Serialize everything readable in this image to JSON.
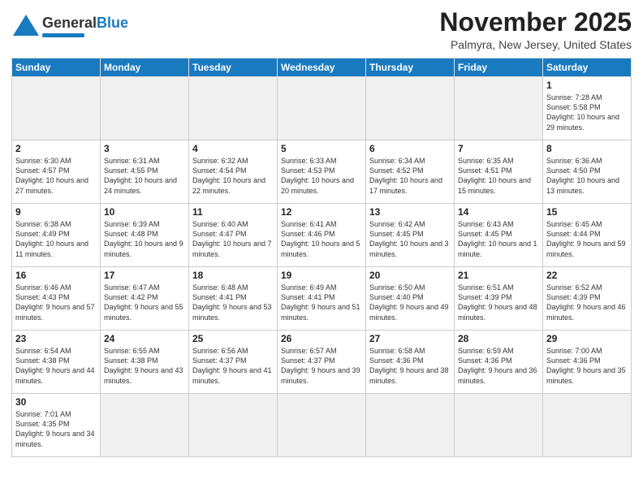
{
  "header": {
    "logo_general": "General",
    "logo_blue": "Blue",
    "month_title": "November 2025",
    "location": "Palmyra, New Jersey, United States"
  },
  "days_of_week": [
    "Sunday",
    "Monday",
    "Tuesday",
    "Wednesday",
    "Thursday",
    "Friday",
    "Saturday"
  ],
  "weeks": [
    [
      {
        "day": "",
        "info": ""
      },
      {
        "day": "",
        "info": ""
      },
      {
        "day": "",
        "info": ""
      },
      {
        "day": "",
        "info": ""
      },
      {
        "day": "",
        "info": ""
      },
      {
        "day": "",
        "info": ""
      },
      {
        "day": "1",
        "info": "Sunrise: 7:28 AM\nSunset: 5:58 PM\nDaylight: 10 hours and 29 minutes."
      }
    ],
    [
      {
        "day": "2",
        "info": "Sunrise: 6:30 AM\nSunset: 4:57 PM\nDaylight: 10 hours and 27 minutes."
      },
      {
        "day": "3",
        "info": "Sunrise: 6:31 AM\nSunset: 4:55 PM\nDaylight: 10 hours and 24 minutes."
      },
      {
        "day": "4",
        "info": "Sunrise: 6:32 AM\nSunset: 4:54 PM\nDaylight: 10 hours and 22 minutes."
      },
      {
        "day": "5",
        "info": "Sunrise: 6:33 AM\nSunset: 4:53 PM\nDaylight: 10 hours and 20 minutes."
      },
      {
        "day": "6",
        "info": "Sunrise: 6:34 AM\nSunset: 4:52 PM\nDaylight: 10 hours and 17 minutes."
      },
      {
        "day": "7",
        "info": "Sunrise: 6:35 AM\nSunset: 4:51 PM\nDaylight: 10 hours and 15 minutes."
      },
      {
        "day": "8",
        "info": "Sunrise: 6:36 AM\nSunset: 4:50 PM\nDaylight: 10 hours and 13 minutes."
      }
    ],
    [
      {
        "day": "9",
        "info": "Sunrise: 6:38 AM\nSunset: 4:49 PM\nDaylight: 10 hours and 11 minutes."
      },
      {
        "day": "10",
        "info": "Sunrise: 6:39 AM\nSunset: 4:48 PM\nDaylight: 10 hours and 9 minutes."
      },
      {
        "day": "11",
        "info": "Sunrise: 6:40 AM\nSunset: 4:47 PM\nDaylight: 10 hours and 7 minutes."
      },
      {
        "day": "12",
        "info": "Sunrise: 6:41 AM\nSunset: 4:46 PM\nDaylight: 10 hours and 5 minutes."
      },
      {
        "day": "13",
        "info": "Sunrise: 6:42 AM\nSunset: 4:45 PM\nDaylight: 10 hours and 3 minutes."
      },
      {
        "day": "14",
        "info": "Sunrise: 6:43 AM\nSunset: 4:45 PM\nDaylight: 10 hours and 1 minute."
      },
      {
        "day": "15",
        "info": "Sunrise: 6:45 AM\nSunset: 4:44 PM\nDaylight: 9 hours and 59 minutes."
      }
    ],
    [
      {
        "day": "16",
        "info": "Sunrise: 6:46 AM\nSunset: 4:43 PM\nDaylight: 9 hours and 57 minutes."
      },
      {
        "day": "17",
        "info": "Sunrise: 6:47 AM\nSunset: 4:42 PM\nDaylight: 9 hours and 55 minutes."
      },
      {
        "day": "18",
        "info": "Sunrise: 6:48 AM\nSunset: 4:41 PM\nDaylight: 9 hours and 53 minutes."
      },
      {
        "day": "19",
        "info": "Sunrise: 6:49 AM\nSunset: 4:41 PM\nDaylight: 9 hours and 51 minutes."
      },
      {
        "day": "20",
        "info": "Sunrise: 6:50 AM\nSunset: 4:40 PM\nDaylight: 9 hours and 49 minutes."
      },
      {
        "day": "21",
        "info": "Sunrise: 6:51 AM\nSunset: 4:39 PM\nDaylight: 9 hours and 48 minutes."
      },
      {
        "day": "22",
        "info": "Sunrise: 6:52 AM\nSunset: 4:39 PM\nDaylight: 9 hours and 46 minutes."
      }
    ],
    [
      {
        "day": "23",
        "info": "Sunrise: 6:54 AM\nSunset: 4:38 PM\nDaylight: 9 hours and 44 minutes."
      },
      {
        "day": "24",
        "info": "Sunrise: 6:55 AM\nSunset: 4:38 PM\nDaylight: 9 hours and 43 minutes."
      },
      {
        "day": "25",
        "info": "Sunrise: 6:56 AM\nSunset: 4:37 PM\nDaylight: 9 hours and 41 minutes."
      },
      {
        "day": "26",
        "info": "Sunrise: 6:57 AM\nSunset: 4:37 PM\nDaylight: 9 hours and 39 minutes."
      },
      {
        "day": "27",
        "info": "Sunrise: 6:58 AM\nSunset: 4:36 PM\nDaylight: 9 hours and 38 minutes."
      },
      {
        "day": "28",
        "info": "Sunrise: 6:59 AM\nSunset: 4:36 PM\nDaylight: 9 hours and 36 minutes."
      },
      {
        "day": "29",
        "info": "Sunrise: 7:00 AM\nSunset: 4:36 PM\nDaylight: 9 hours and 35 minutes."
      }
    ],
    [
      {
        "day": "30",
        "info": "Sunrise: 7:01 AM\nSunset: 4:35 PM\nDaylight: 9 hours and 34 minutes."
      },
      {
        "day": "",
        "info": ""
      },
      {
        "day": "",
        "info": ""
      },
      {
        "day": "",
        "info": ""
      },
      {
        "day": "",
        "info": ""
      },
      {
        "day": "",
        "info": ""
      },
      {
        "day": "",
        "info": ""
      }
    ]
  ]
}
